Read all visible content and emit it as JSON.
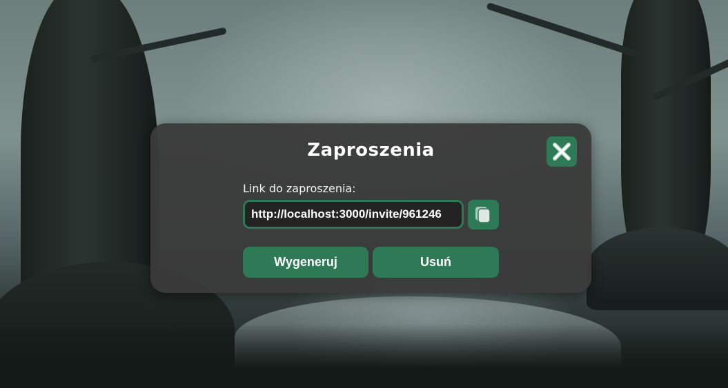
{
  "background": {
    "description_icon": "swamp-forest-wallpaper"
  },
  "modal": {
    "title": "Zaproszenia",
    "close_icon": "close-x-icon",
    "invite_label": "Link do zaproszenia:",
    "invite_link": "http://localhost:3000/invite/961246",
    "copy_icon": "copy-icon",
    "generate_label": "Wygeneruj",
    "delete_label": "Usuń"
  },
  "colors": {
    "accent": "#2e7a57",
    "modal_bg": "#3a3a3a",
    "input_bg": "#232323",
    "text": "#ffffff"
  }
}
